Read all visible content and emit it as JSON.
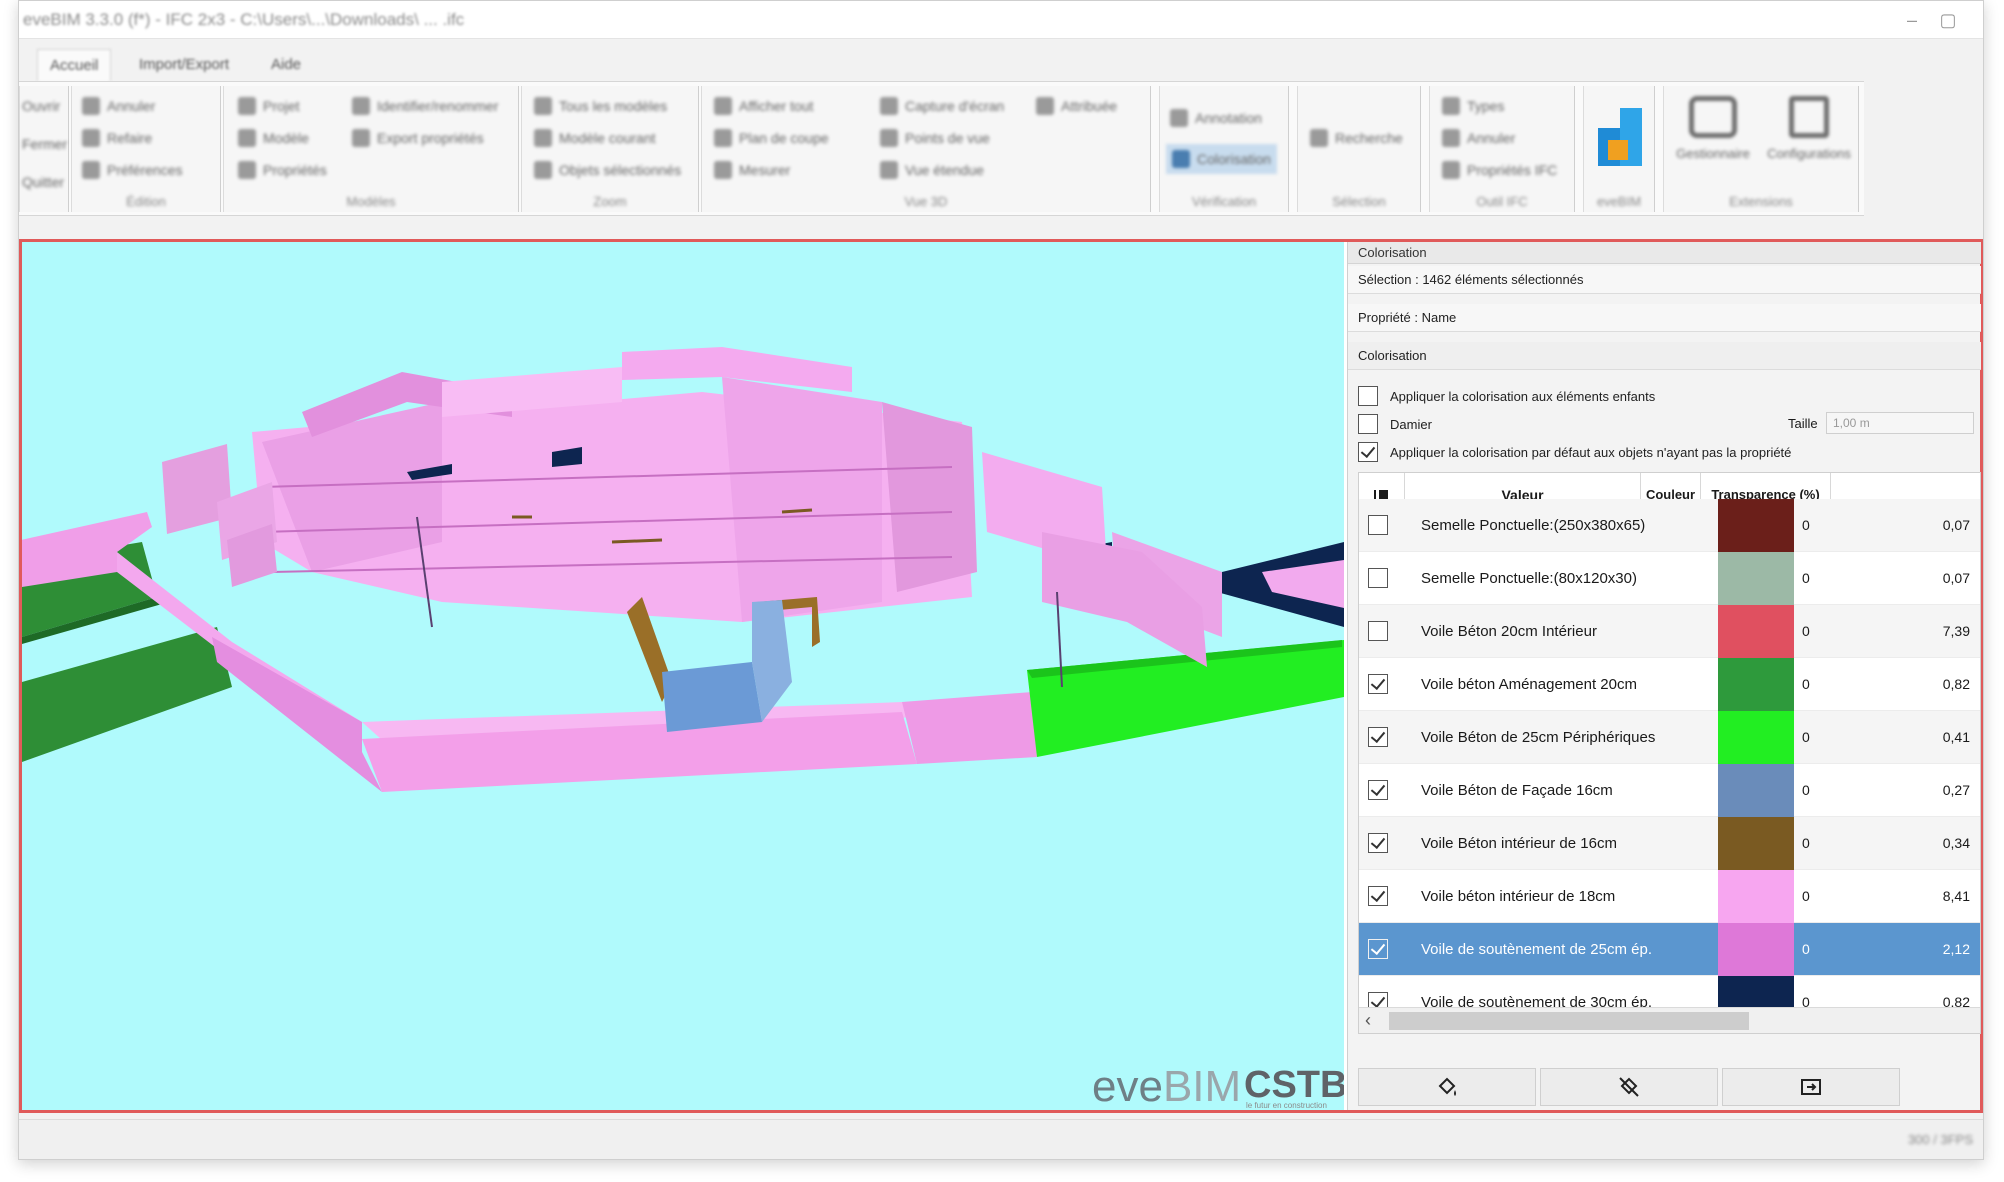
{
  "window": {
    "title": "eveBIM 3.3.0 (f*) - IFC 2x3 - C:\\Users\\...\\Downloads\\ ... .ifc"
  },
  "menu_tabs": [
    "Accueil",
    "Import/Export",
    "Aide"
  ],
  "ribbon": {
    "groups": [
      {
        "label": "",
        "items": [
          "Ouvrir",
          "Fermer",
          "Quitter"
        ]
      },
      {
        "label": "Édition",
        "items": [
          "Annuler",
          "Refaire",
          "Préférences"
        ]
      },
      {
        "label": "Modèles",
        "items": [
          "Projet",
          "Modèle",
          "Propriétés",
          "Identifier/renommer",
          "Export propriétés"
        ]
      },
      {
        "label": "Zoom",
        "items": [
          "Tous les modèles",
          "Modèle courant",
          "Objets sélectionnés"
        ]
      },
      {
        "label": "Vue 3D",
        "items": [
          "Afficher tout",
          "Plan de coupe",
          "Mesurer",
          "Capture d'écran",
          "Points de vue",
          "Vue étendue",
          "Attribuée"
        ]
      },
      {
        "label": "Vérification",
        "items": [
          "Annotation",
          "Colorisation"
        ]
      },
      {
        "label": "Sélection",
        "items": [
          "Recherche"
        ]
      },
      {
        "label": "Outil IFC",
        "items": [
          "Types",
          "Annuler",
          "Propriétés IFC"
        ]
      },
      {
        "label": "eveBIM",
        "items": [
          "",
          ""
        ]
      },
      {
        "label": "Extensions",
        "items": [
          "Gestionnaire",
          "Configurations"
        ]
      }
    ]
  },
  "viewport": {
    "logo_left_a": "eve",
    "logo_left_b": "BIM",
    "logo_right": "CSTB",
    "logo_right_sub": "le futur en construction"
  },
  "panel": {
    "title": "Colorisation",
    "selection": "Sélection : 1462 éléments sélectionnés",
    "property": "Propriété : Name",
    "section": "Colorisation",
    "options": [
      {
        "label": "Appliquer la colorisation aux éléments enfants",
        "checked": false
      },
      {
        "label": "Damier",
        "checked": false
      },
      {
        "label": "Appliquer la colorisation par défaut aux objets n'ayant pas la propriété",
        "checked": true
      }
    ],
    "taille_label": "Taille",
    "taille_value": "1,00 m",
    "table": {
      "headers": [
        "Valeur",
        "Couleur",
        "Transparence (%)"
      ],
      "rows": [
        {
          "name": "Semelle Ponctuelle:(250x380x65)",
          "color": "#6b1f1a",
          "transparency": "0",
          "pct": "0,07",
          "checked": false
        },
        {
          "name": "Semelle Ponctuelle:(80x120x30)",
          "color": "#9cb9a6",
          "transparency": "0",
          "pct": "0,07",
          "checked": false
        },
        {
          "name": "Voile Béton 20cm Intérieur",
          "color": "#e05060",
          "transparency": "0",
          "pct": "7,39",
          "checked": false
        },
        {
          "name": "Voile béton Aménagement 20cm",
          "color": "#2e9a3c",
          "transparency": "0",
          "pct": "0,82",
          "checked": true
        },
        {
          "name": "Voile Béton de 25cm Périphériques",
          "color": "#22ee22",
          "transparency": "0",
          "pct": "0,41",
          "checked": true
        },
        {
          "name": "Voile Béton de Façade 16cm",
          "color": "#6a8cba",
          "transparency": "0",
          "pct": "0,27",
          "checked": true
        },
        {
          "name": "Voile Béton intérieur de 16cm",
          "color": "#7a5a22",
          "transparency": "0",
          "pct": "0,34",
          "checked": true
        },
        {
          "name": "Voile béton intérieur de 18cm",
          "color": "#f7a6f0",
          "transparency": "0",
          "pct": "8,41",
          "checked": true
        },
        {
          "name": "Voile de soutènement de 25cm ép.",
          "color": "#de78d8",
          "transparency": "0",
          "pct": "2,12",
          "checked": true
        },
        {
          "name": "Voile de soutènement de 30cm ép.",
          "color": "#0d2550",
          "transparency": "0",
          "pct": "0,82",
          "checked": true
        }
      ],
      "selected_index": 8
    }
  },
  "status": {
    "right": "300 / 3FPS"
  }
}
